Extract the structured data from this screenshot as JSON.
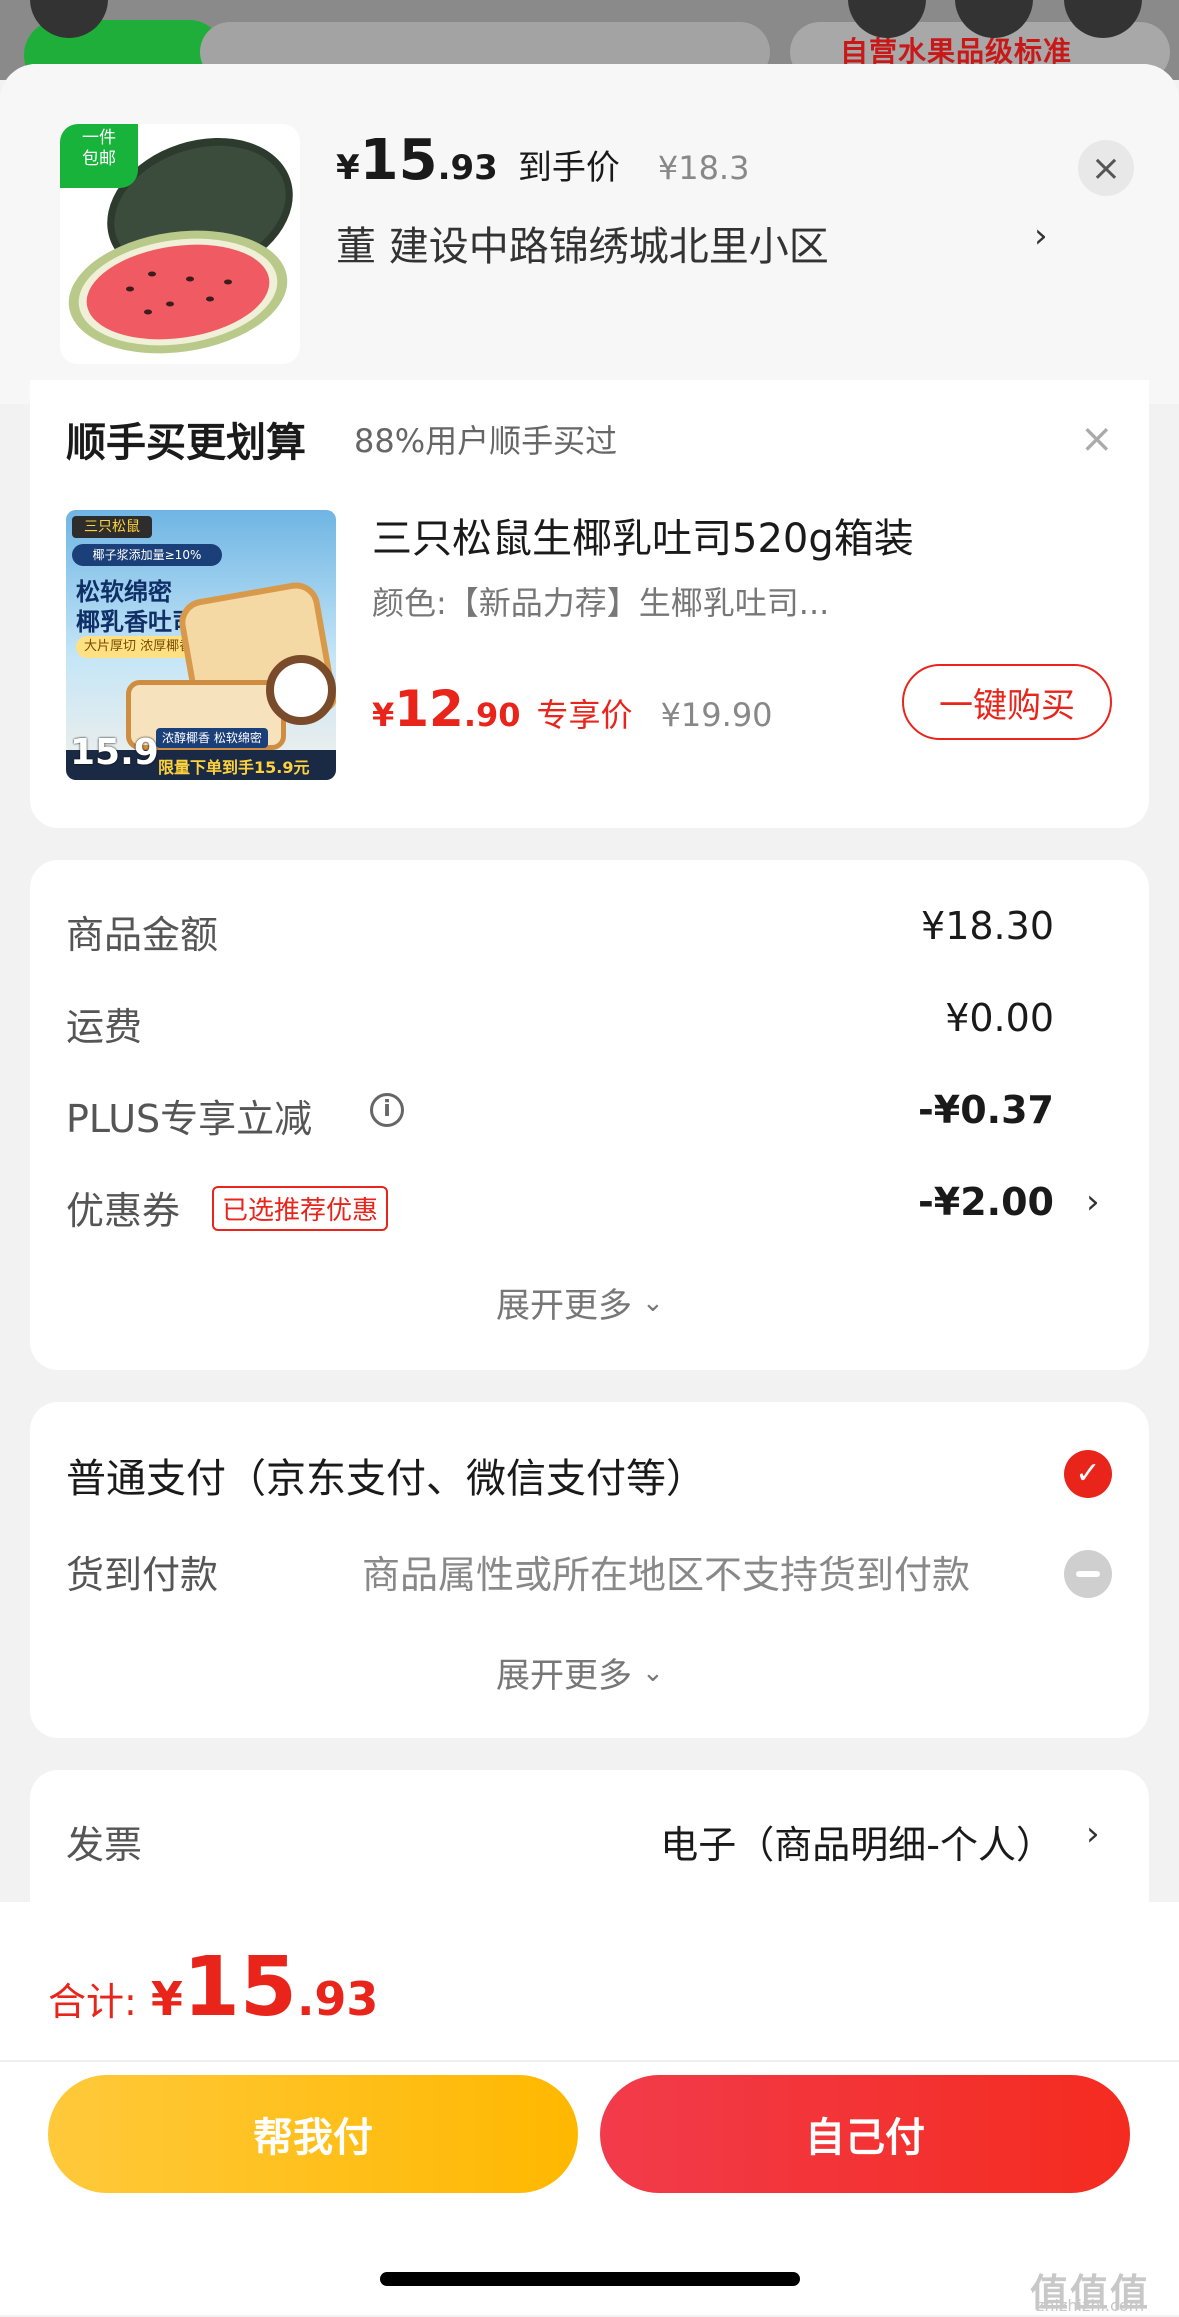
{
  "background": {
    "banner_text": "自营水果品级标准"
  },
  "header": {
    "thumb_tag": "一件\n包邮",
    "price_symbol": "¥",
    "price_int": "15",
    "price_dec": ".93",
    "price_label": "到手价",
    "orig_price": "¥18.3",
    "address": "董  建设中路锦绣城北里小区",
    "close_icon": "close-icon"
  },
  "upsell": {
    "title": "顺手买更划算",
    "subtitle": "88%用户顺手买过",
    "product_name": "三只松鼠生椰乳吐司520g箱装",
    "spec": "颜色:【新品力荐】生椰乳吐司...",
    "price_symbol": "¥",
    "price_int": "12",
    "price_dec": ".90",
    "price_label": "专享价",
    "orig_price": "¥19.90",
    "buy_button": "一键购买",
    "image": {
      "brand": "三只松鼠",
      "tag1": "椰子浆添加量≥10%",
      "headline1": "松软绵密",
      "headline2": "椰乳香吐司",
      "subline": "大片厚切 浓厚椰香",
      "chip": "浓醇椰香 松软绵密",
      "badge_price": "15.9",
      "footer": "限量下单到手15.9元"
    }
  },
  "summary": {
    "rows": [
      {
        "label": "商品金额",
        "value": "¥18.30"
      },
      {
        "label": "运费",
        "value": "¥0.00"
      },
      {
        "label": "PLUS专享立减",
        "value": "-¥0.37"
      },
      {
        "label": "优惠券",
        "value": "-¥2.00",
        "tag": "已选推荐优惠"
      }
    ],
    "expand": "展开更多"
  },
  "payment": {
    "option1": "普通支付（京东支付、微信支付等）",
    "option2_label": "货到付款",
    "option2_note": "商品属性或所在地区不支持货到付款",
    "expand": "展开更多"
  },
  "invoice": {
    "label": "发票",
    "value": "电子（商品明细-个人）"
  },
  "footer": {
    "total_label": "合计:",
    "total_symbol": "¥",
    "total_int": "15",
    "total_dec": ".93",
    "help_pay": "帮我付",
    "self_pay": "自己付",
    "watermark": "值值值",
    "watermark_sub": "zhizhizhi.com"
  },
  "colors": {
    "accent_red": "#e8241b",
    "green": "#17b33b",
    "yellow": "#ffc93b"
  }
}
